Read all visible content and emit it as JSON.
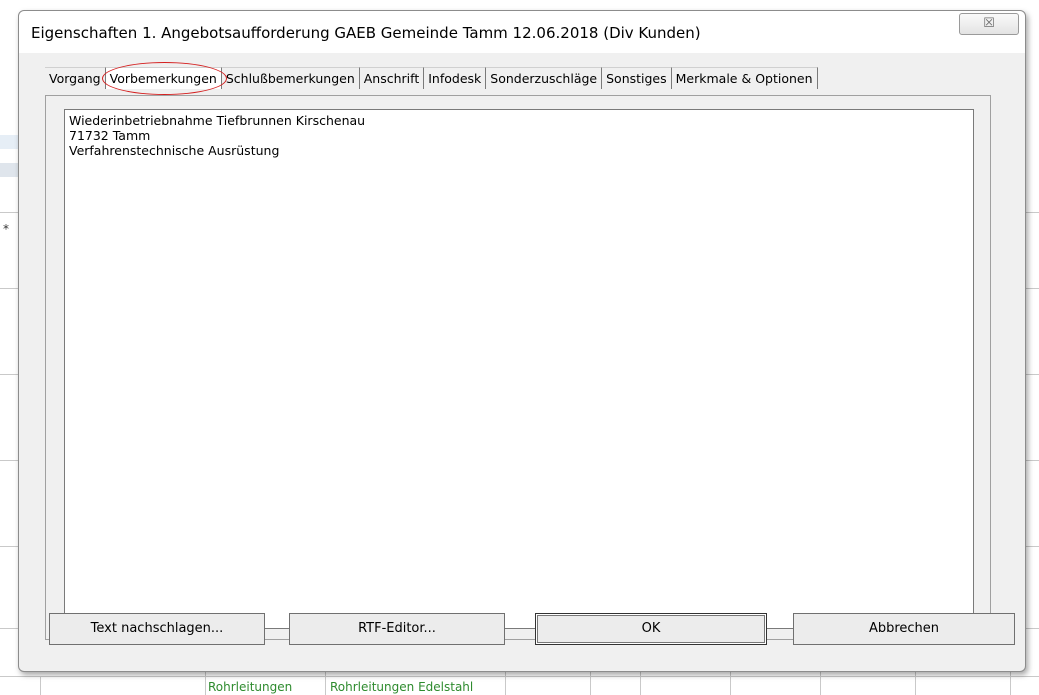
{
  "window": {
    "title": "Eigenschaften 1. Angebotsaufforderung GAEB Gemeinde Tamm 12.06.2018 (Div Kunden)",
    "close_glyph": "☒"
  },
  "tabs": [
    {
      "label": "Vorgang",
      "active": false
    },
    {
      "label": "Vorbemerkungen",
      "active": true
    },
    {
      "label": "Schlußbemerkungen",
      "active": false
    },
    {
      "label": "Anschrift",
      "active": false
    },
    {
      "label": "Infodesk",
      "active": false
    },
    {
      "label": "Sonderzuschläge",
      "active": false
    },
    {
      "label": "Sonstiges",
      "active": false
    },
    {
      "label": "Merkmale & Optionen",
      "active": false
    }
  ],
  "editor": {
    "lines": [
      "Wiederinbetriebnahme Tiefbrunnen Kirschenau",
      "71732 Tamm",
      "Verfahrenstechnische Ausrüstung"
    ]
  },
  "buttons": {
    "lookup": "Text nachschlagen...",
    "rtf_editor": "RTF-Editor...",
    "ok": "OK",
    "cancel": "Abbrechen"
  },
  "background": {
    "star": "*",
    "cell_1": "Rohrleitungen",
    "cell_2": "Rohrleitungen Edelstahl"
  },
  "colors": {
    "annotation_circle": "#d42020",
    "background_cell_text": "#2e8b2e"
  }
}
